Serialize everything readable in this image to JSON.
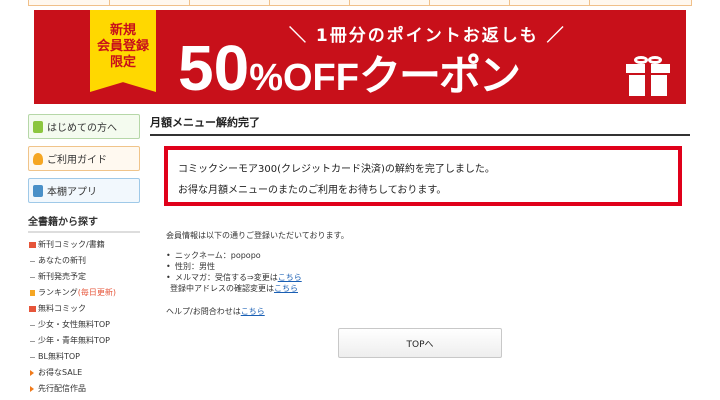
{
  "banner": {
    "badge_line1": "新規",
    "badge_line2": "会員登録",
    "badge_line3": "限定",
    "top_text": "＼ 1冊分のポイントお返しも ／",
    "percent": "50",
    "percent_sign": "%",
    "off": "OFF",
    "coupon": "クーポン"
  },
  "sidebar": {
    "buttons": [
      {
        "label": "はじめての方へ"
      },
      {
        "label": "ご利用ガイド"
      },
      {
        "label": "本棚アプリ"
      }
    ],
    "heading": "全書籍から探す",
    "items": [
      {
        "label": "新刊コミック/書籍",
        "note": ""
      },
      {
        "label": "あなたの新刊",
        "note": ""
      },
      {
        "label": "新刊発売予定",
        "note": ""
      },
      {
        "label": "ランキング",
        "note": "(毎日更新)"
      },
      {
        "label": "無料コミック",
        "note": ""
      },
      {
        "label": "少女・女性無料TOP",
        "note": ""
      },
      {
        "label": "少年・青年無料TOP",
        "note": ""
      },
      {
        "label": "BL無料TOP",
        "note": ""
      },
      {
        "label": "お得なSALE",
        "note": ""
      },
      {
        "label": "先行配信作品",
        "note": ""
      }
    ]
  },
  "main": {
    "title": "月額メニュー解約完了",
    "notice_line1": "コミックシーモア300(クレジットカード決済)の解約を完了しました。",
    "notice_line2": "お得な月額メニューのまたのご利用をお待ちしております。",
    "info_intro": "会員情報は以下の通りご登録いただいております。",
    "nickname_label": "ニックネーム：popopo",
    "gender_label": "性別：男性",
    "mailmag_label": "メルマガ：受信する⇒変更は",
    "mailmag_link": "こちら",
    "address_label": "登録中アドレスの確認変更は",
    "address_link": "こちら",
    "help_label": "ヘルプ/お問合わせは",
    "help_link": "こちら",
    "top_button": "TOPへ"
  }
}
